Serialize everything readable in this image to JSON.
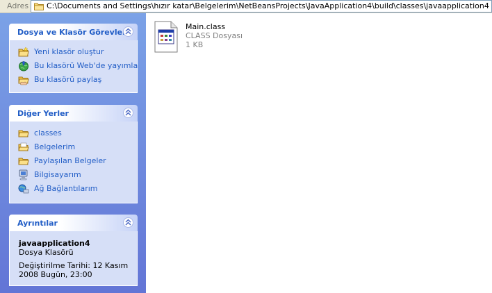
{
  "address": {
    "label": "Adres",
    "path": "C:\\Documents and Settings\\hızır katar\\Belgelerim\\NetBeansProjects\\JavaApplication4\\build\\classes\\javaapplication4"
  },
  "tasks_panel": {
    "title": "Dosya ve Klasör Görevleri",
    "items": [
      {
        "label": "Yeni klasör oluştur",
        "icon": "new-folder-icon"
      },
      {
        "label": "Bu klasörü Web'de yayımla",
        "icon": "web-publish-icon"
      },
      {
        "label": "Bu klasörü paylaş",
        "icon": "share-folder-icon"
      }
    ]
  },
  "places_panel": {
    "title": "Diğer Yerler",
    "items": [
      {
        "label": "classes",
        "icon": "folder-icon"
      },
      {
        "label": "Belgelerim",
        "icon": "my-documents-icon"
      },
      {
        "label": "Paylaşılan Belgeler",
        "icon": "shared-documents-icon"
      },
      {
        "label": "Bilgisayarım",
        "icon": "my-computer-icon"
      },
      {
        "label": "Ağ Bağlantılarım",
        "icon": "network-icon"
      }
    ]
  },
  "details_panel": {
    "title": "Ayrıntılar",
    "name": "javaapplication4",
    "type": "Dosya Klasörü",
    "modified": "Değiştirilme Tarihi: 12 Kasım 2008 Bugün, 23:00"
  },
  "file": {
    "name": "Main.class",
    "type": "CLASS Dosyası",
    "size": "1 KB"
  },
  "colors": {
    "pane_top": "#7ba2e7",
    "pane_bottom": "#6375d6",
    "link": "#215dc6",
    "panel_body": "#d6dff7"
  }
}
